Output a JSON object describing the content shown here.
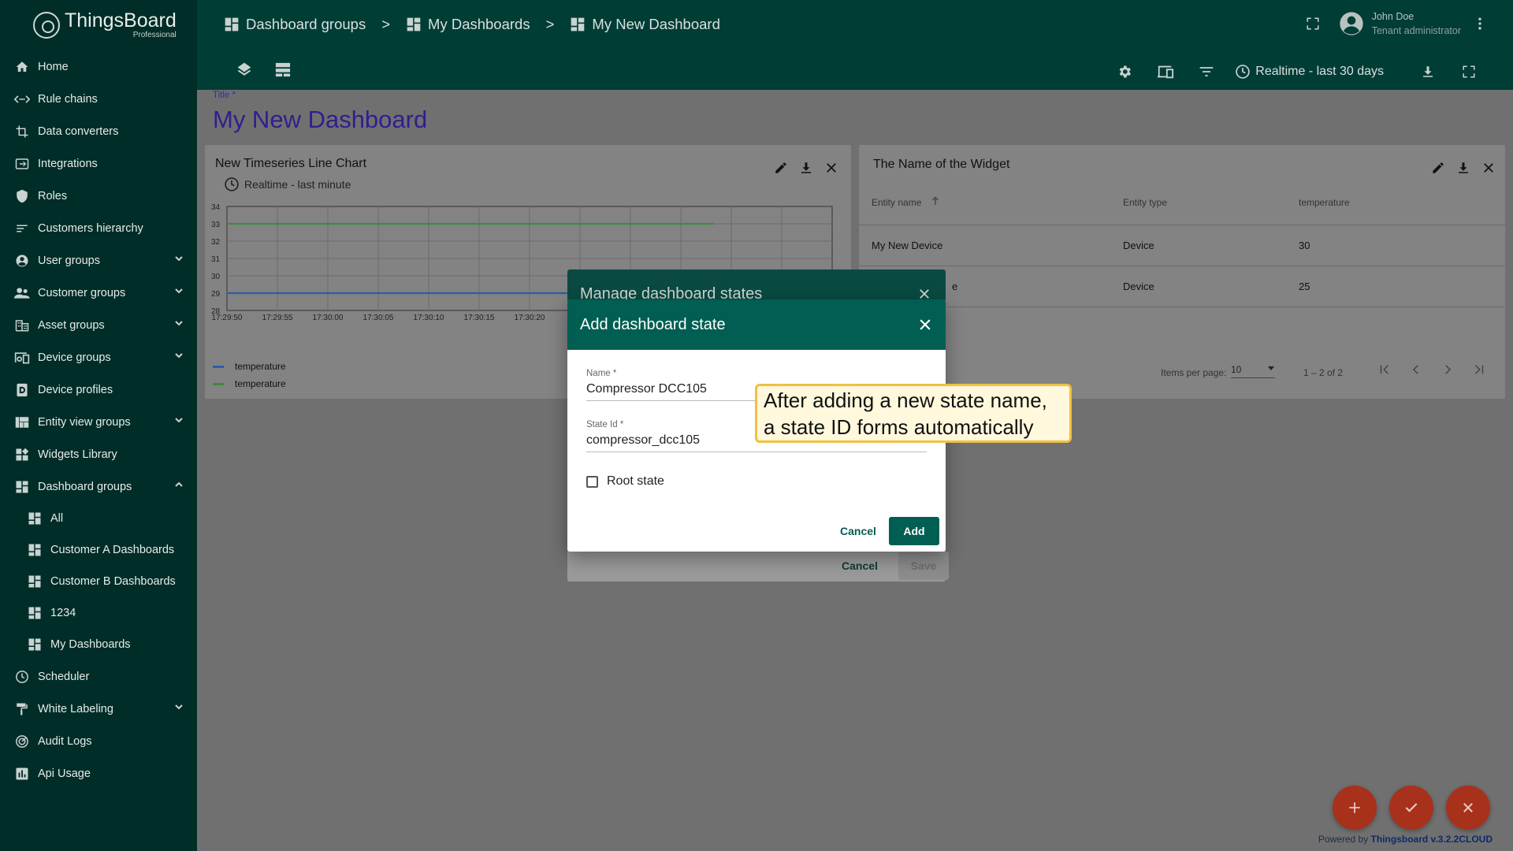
{
  "sidebar": {
    "logo_name": "ThingsBoard",
    "logo_sub": "Professional",
    "items": [
      {
        "label": "Home",
        "icon": "home-icon"
      },
      {
        "label": "Rule chains",
        "icon": "rule-chain-icon"
      },
      {
        "label": "Data converters",
        "icon": "converter-icon"
      },
      {
        "label": "Integrations",
        "icon": "integration-icon"
      },
      {
        "label": "Roles",
        "icon": "shield-icon"
      },
      {
        "label": "Customers hierarchy",
        "icon": "hierarchy-icon"
      },
      {
        "label": "User groups",
        "icon": "account-icon"
      },
      {
        "label": "Customer groups",
        "icon": "supervisor-icon"
      },
      {
        "label": "Asset groups",
        "icon": "domain-icon"
      },
      {
        "label": "Device groups",
        "icon": "devices-icon"
      },
      {
        "label": "Device profiles",
        "icon": "device-profile-icon"
      },
      {
        "label": "Entity view groups",
        "icon": "view-quilt-icon"
      },
      {
        "label": "Widgets Library",
        "icon": "widgets-icon"
      },
      {
        "label": "Dashboard groups",
        "icon": "dashboard-icon"
      },
      {
        "label": "Scheduler",
        "icon": "clock-icon"
      },
      {
        "label": "White Labeling",
        "icon": "paint-roller-icon"
      },
      {
        "label": "Audit Logs",
        "icon": "track-changes-icon"
      },
      {
        "label": "Api Usage",
        "icon": "insert-chart-icon"
      }
    ],
    "sub_items": [
      "All",
      "Customer A Dashboards",
      "Customer B Dashboards",
      "1234",
      "My Dashboards"
    ]
  },
  "topbar": {
    "crumbs": [
      "Dashboard groups",
      "My Dashboards",
      "My New Dashboard"
    ],
    "separator": ">",
    "user_name": "John Doe",
    "user_role": "Tenant administrator",
    "realtime": "Realtime - last 30 days"
  },
  "dashboard": {
    "title_label": "Title *",
    "title_value": "My New Dashboard"
  },
  "chart_widget": {
    "title": "New Timeseries Line Chart",
    "subtitle": "Realtime - last minute",
    "legend": [
      "temperature",
      "temperature"
    ]
  },
  "chart_data": {
    "type": "line",
    "x": [
      "17:29:50",
      "17:29:55",
      "17:30:00",
      "17:30:05",
      "17:30:10",
      "17:30:15",
      "17:30:20"
    ],
    "yticks": [
      "34",
      "33",
      "32",
      "31",
      "30",
      "29",
      "28"
    ],
    "ylim": [
      28,
      34
    ],
    "series": [
      {
        "name": "temperature",
        "color": "#2a5fa8",
        "values": [
          29,
          29,
          29,
          29,
          29,
          29,
          29
        ]
      },
      {
        "name": "temperature",
        "color": "#3e8a3e",
        "values": [
          33,
          33,
          33,
          33,
          33,
          33,
          33
        ]
      }
    ],
    "grid": true
  },
  "table_widget": {
    "title": "The Name of the Widget",
    "headers": [
      "Entity name",
      "Entity type",
      "temperature"
    ],
    "rows": [
      {
        "name": "My New Device",
        "type": "Device",
        "value": "30"
      },
      {
        "name": "e",
        "type": "Device",
        "value": "25"
      }
    ],
    "items_per_page_label": "Items per page:",
    "items_per_page": "10",
    "range": "1 – 2 of 2"
  },
  "back_dialog": {
    "title": "Manage dashboard states",
    "cancel": "Cancel",
    "save": "Save"
  },
  "dialog": {
    "title": "Add dashboard state",
    "name_label": "Name *",
    "name_value": "Compressor DCC105",
    "stateid_label": "State Id *",
    "stateid_value": "compressor_dcc105",
    "root_label": "Root state",
    "cancel": "Cancel",
    "add": "Add"
  },
  "callout": {
    "line1": "After adding a new state name,",
    "line2": "a state ID forms automatically"
  },
  "footer": {
    "powered_prefix": "Powered by ",
    "powered_link": "Thingsboard v.3.2.2CLOUD"
  }
}
